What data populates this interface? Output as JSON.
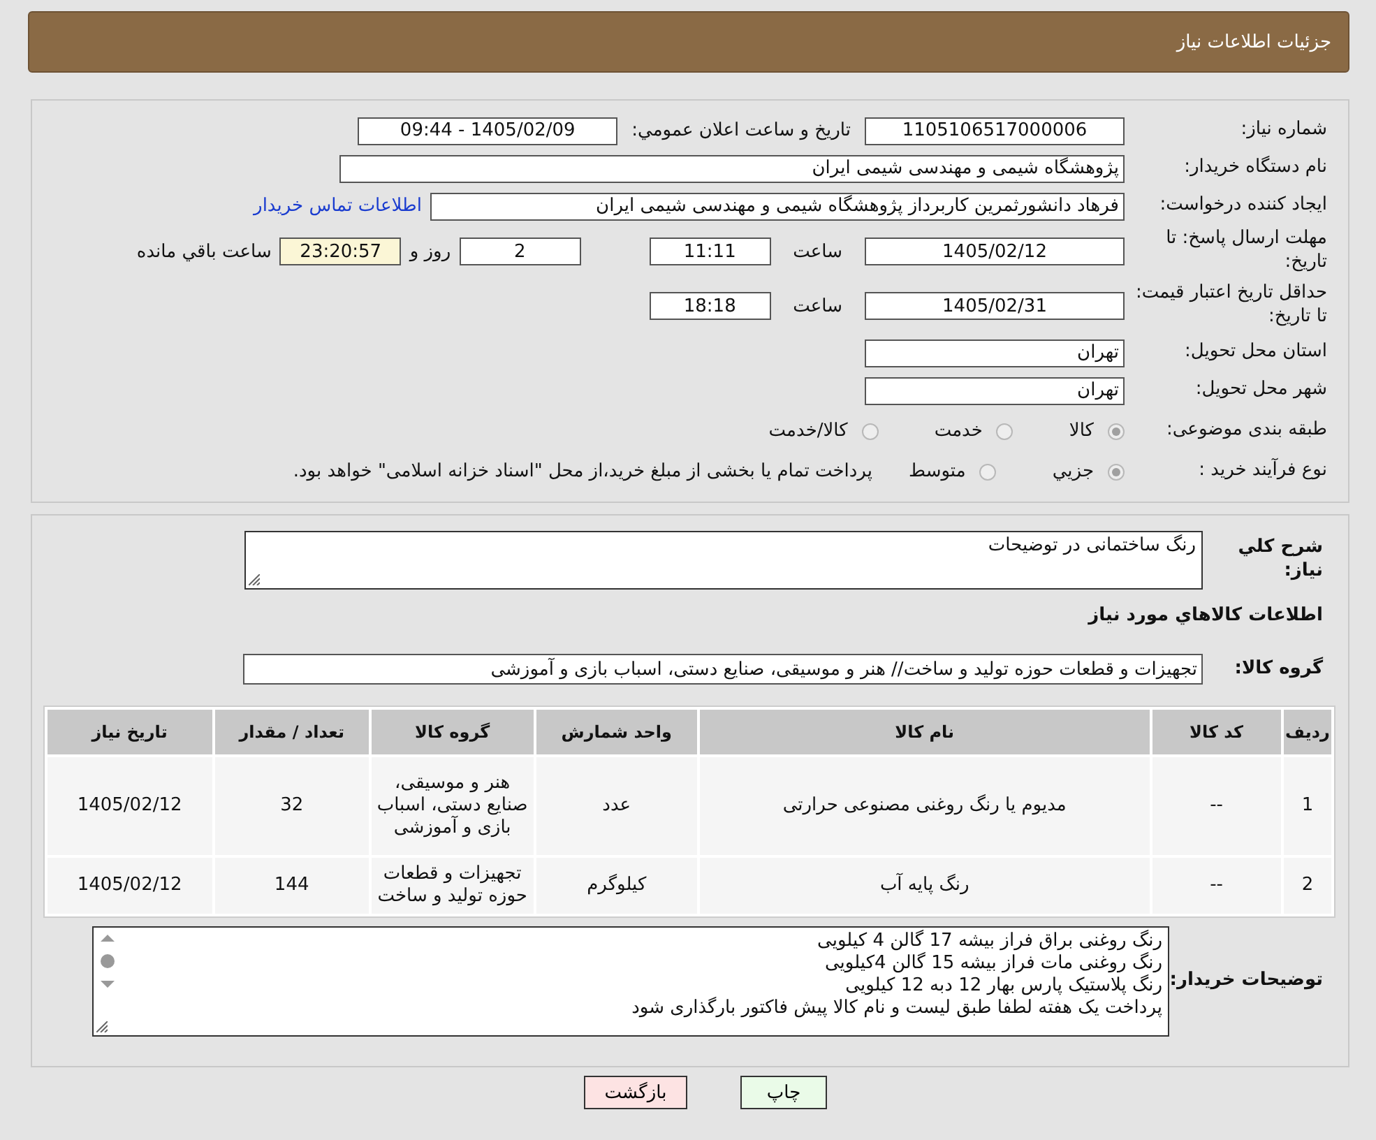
{
  "header": {
    "title": "جزئیات اطلاعات نیاز"
  },
  "details": {
    "need_number": {
      "label": "شماره نیاز:",
      "value": "1105106517000006"
    },
    "announce": {
      "label": "تاریخ و ساعت اعلان عمومي:",
      "value": "1405/02/09 - 09:44"
    },
    "buyer": {
      "label": "نام دستگاه خریدار:",
      "value": "پژوهشگاه شیمی و مهندسی شیمی ایران"
    },
    "creator": {
      "label": "ایجاد کننده درخواست:",
      "value": "فرهاد دانشورثمرین کاربرداز پژوهشگاه شیمی و مهندسی شیمی ایران",
      "link": "اطلاعات تماس خریدار"
    },
    "deadline": {
      "label": "مهلت ارسال پاسخ: تا تاریخ:",
      "date": "1405/02/12",
      "time_label": "ساعت",
      "time": "11:11",
      "days": "2",
      "days_label": "روز و",
      "remaining": "23:20:57",
      "remaining_label": "ساعت باقي مانده"
    },
    "validity": {
      "label": "حداقل تاریخ اعتبار قیمت: تا تاریخ:",
      "date": "1405/02/31",
      "time_label": "ساعت",
      "time": "18:18"
    },
    "province": {
      "label": "استان محل تحویل:",
      "value": "تهران"
    },
    "city": {
      "label": "شهر محل تحویل:",
      "value": "تهران"
    },
    "category": {
      "label": "طبقه بندی موضوعی:",
      "options": [
        {
          "label": "کالا",
          "selected": true
        },
        {
          "label": "خدمت",
          "selected": false
        },
        {
          "label": "کالا/خدمت",
          "selected": false
        }
      ]
    },
    "process": {
      "label": "نوع فرآیند خرید :",
      "options": [
        {
          "label": "جزیي",
          "selected": true
        },
        {
          "label": "متوسط",
          "selected": false
        }
      ],
      "note": "پرداخت تمام یا بخشی از مبلغ خرید،از محل \"اسناد خزانه اسلامی\" خواهد بود."
    }
  },
  "summary": {
    "label": "شرح كلي نياز:",
    "value": "رنگ ساختمانی در توضیحات"
  },
  "goods_heading": "اطلاعات كالاهاي مورد نياز",
  "goods_group": {
    "label": "گروه کالا:",
    "value": "تجهیزات و قطعات حوزه تولید و ساخت// هنر و موسیقی، صنایع دستی، اسباب بازی و آموزشی"
  },
  "table": {
    "columns": [
      "ردیف",
      "کد کالا",
      "نام کالا",
      "واحد شمارش",
      "گروه کالا",
      "تعداد / مقدار",
      "تاریخ نیاز"
    ],
    "rows": [
      [
        "1",
        "--",
        "مدیوم یا رنگ روغنی مصنوعی حرارتی",
        "عدد",
        "هنر و موسیقی، صنایع دستی، اسباب بازی و آموزشی",
        "32",
        "1405/02/12"
      ],
      [
        "2",
        "--",
        "رنگ پایه آب",
        "کیلوگرم",
        "تجهیزات و قطعات حوزه تولید و ساخت",
        "144",
        "1405/02/12"
      ]
    ]
  },
  "buyer_notes": {
    "label": "توضیحات خریدار:",
    "lines": [
      "رنگ روغنی براق فراز بیشه 17 گالن 4 کیلویی",
      "رنگ روغنی مات فراز بیشه 15 گالن 4کیلویی",
      "رنگ پلاستیک پارس بهار 12 دبه 12 کیلویی",
      "پرداخت یک هفته لطفا طبق لیست و نام کالا پیش فاکتور بارگذاری شود"
    ]
  },
  "buttons": [
    {
      "label": "چاپ",
      "kind": "print"
    },
    {
      "label": "بازگشت",
      "kind": "back"
    }
  ]
}
